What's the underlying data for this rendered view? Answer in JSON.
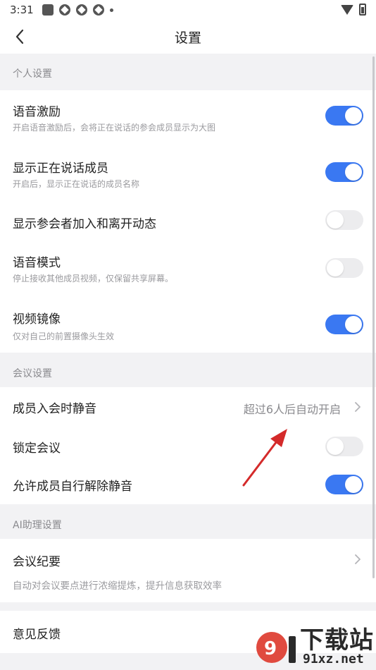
{
  "status": {
    "time": "3:31"
  },
  "nav": {
    "title": "设置"
  },
  "sections": {
    "personal": "个人设置",
    "meeting": "会议设置",
    "ai": "AI助理设置"
  },
  "personal_rows": [
    {
      "title": "语音激励",
      "subtitle": "开启语音激励后，会将正在说话的参会成员显示为大图",
      "toggle": "on"
    },
    {
      "title": "显示正在说话成员",
      "subtitle": "开启后，显示正在说话的成员名称",
      "toggle": "on"
    },
    {
      "title": "显示参会者加入和离开动态",
      "subtitle": "",
      "toggle": "off"
    },
    {
      "title": "语音模式",
      "subtitle": "停止接收其他成员视频，仅保留共享屏幕。",
      "toggle": "off"
    },
    {
      "title": "视频镜像",
      "subtitle": "仅对自己的前置摄像头生效",
      "toggle": "on"
    }
  ],
  "meeting_rows": [
    {
      "title": "成员入会时静音",
      "value": "超过6人后自动开启"
    },
    {
      "title": "锁定会议",
      "toggle": "off"
    },
    {
      "title": "允许成员自行解除静音",
      "toggle": "on"
    }
  ],
  "ai_rows": [
    {
      "title": "会议纪要",
      "subtitle": "自动对会议要点进行浓缩提炼，提升信息获取效率"
    }
  ],
  "feedback": {
    "title": "意见反馈"
  },
  "watermark": {
    "brand": "下载站",
    "domain": "91xz.net"
  },
  "colors": {
    "toggle_on": "#3a78f2",
    "toggle_off": "#ececee",
    "arrow": "#d42a2a"
  }
}
